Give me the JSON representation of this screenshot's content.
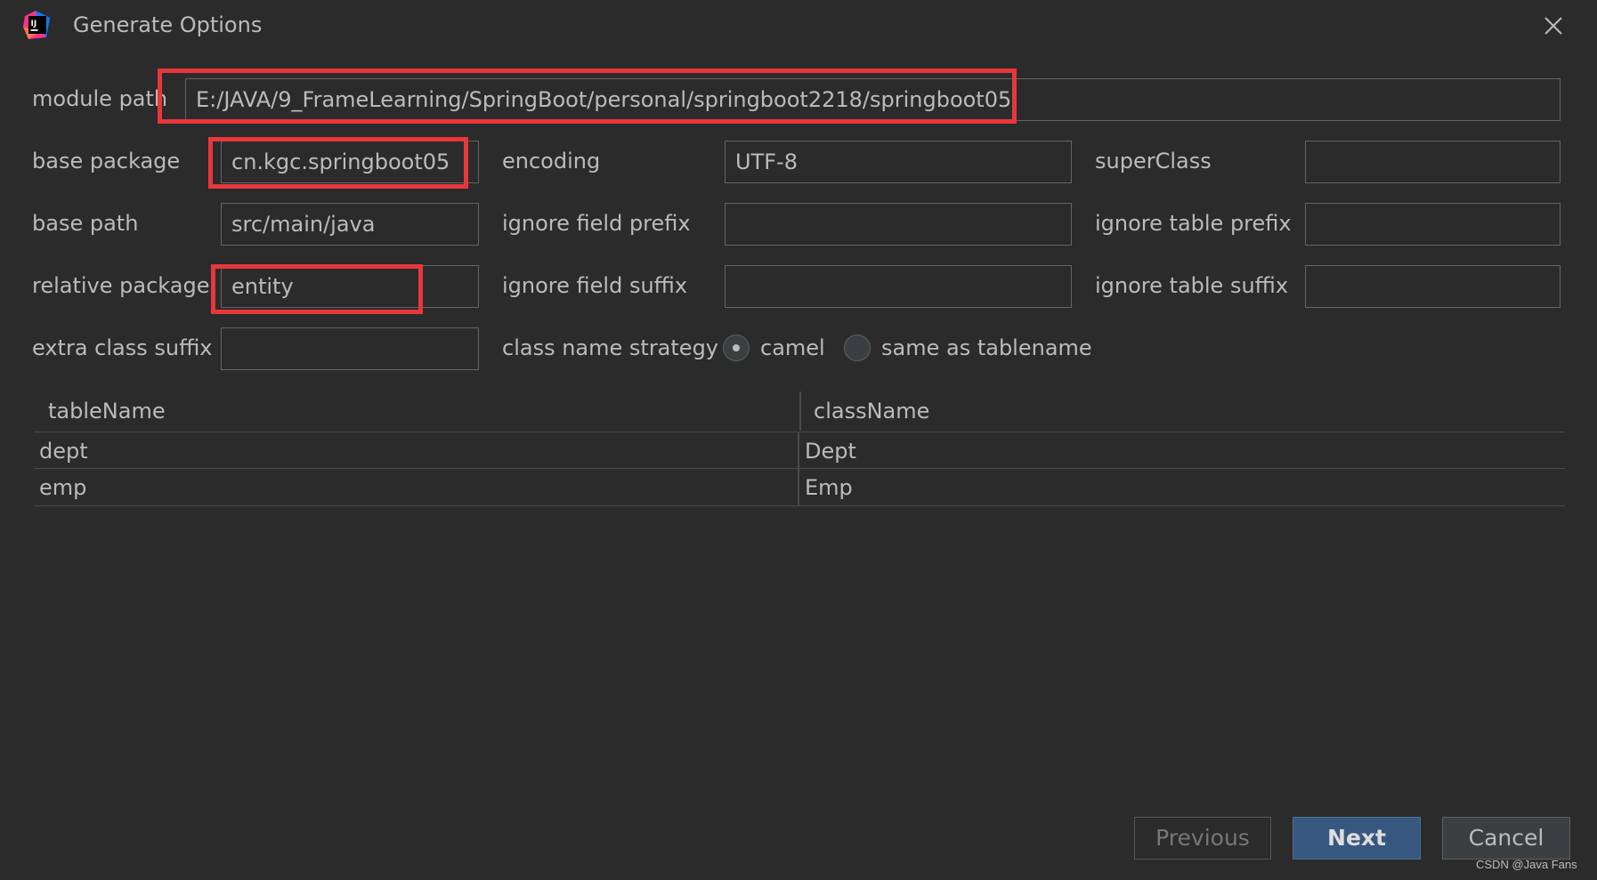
{
  "window": {
    "title": "Generate Options"
  },
  "fields": {
    "module_path": {
      "label": "module path",
      "value": "E:/JAVA/9_FrameLearning/SpringBoot/personal/springboot2218/springboot05"
    },
    "base_package": {
      "label": "base package",
      "value": "cn.kgc.springboot05"
    },
    "encoding": {
      "label": "encoding",
      "value": "UTF-8"
    },
    "super_class": {
      "label": "superClass",
      "value": ""
    },
    "base_path": {
      "label": "base path",
      "value": "src/main/java"
    },
    "ignore_field_prefix": {
      "label": "ignore field prefix",
      "value": ""
    },
    "ignore_table_prefix": {
      "label": "ignore table prefix",
      "value": ""
    },
    "relative_package": {
      "label": "relative package",
      "value": "entity"
    },
    "ignore_field_suffix": {
      "label": "ignore field suffix",
      "value": ""
    },
    "ignore_table_suffix": {
      "label": "ignore table suffix",
      "value": ""
    },
    "extra_class_suffix": {
      "label": "extra class suffix",
      "value": ""
    }
  },
  "class_name_strategy": {
    "label": "class name strategy",
    "options": [
      {
        "label": "camel",
        "selected": true
      },
      {
        "label": "same as tablename",
        "selected": false
      }
    ]
  },
  "table": {
    "columns": [
      "tableName",
      "className"
    ],
    "rows": [
      [
        "dept",
        "Dept"
      ],
      [
        "emp",
        "Emp"
      ]
    ]
  },
  "buttons": {
    "previous": "Previous",
    "next": "Next",
    "cancel": "Cancel"
  },
  "watermark": "CSDN @Java Fans",
  "colors": {
    "background": "#2b2b2b",
    "highlight": "#e8373b",
    "primary_button": "#365880",
    "text": "#bbbbbb"
  }
}
